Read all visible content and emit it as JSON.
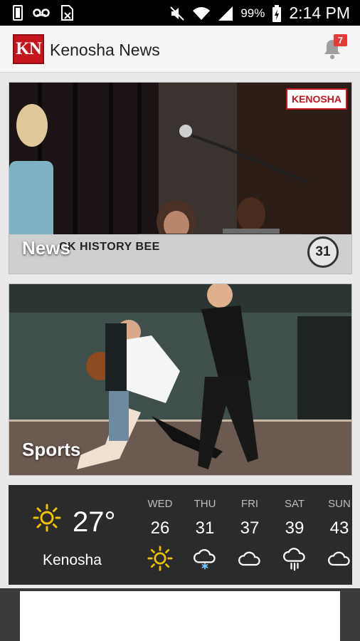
{
  "status_bar": {
    "battery": "99%",
    "time": "2:14 PM"
  },
  "app": {
    "logo_text": "KN",
    "title": "Kenosha News",
    "notification_count": "7"
  },
  "cards": [
    {
      "label": "News",
      "banner_text": "CK HISTORY BEE",
      "badge_number": "31",
      "tag_text": "KENOSHA"
    },
    {
      "label": "Sports"
    }
  ],
  "weather": {
    "current_temp": "27°",
    "city": "Kenosha",
    "current_icon": "sun-icon",
    "forecast": [
      {
        "day": "WED",
        "temp": "26",
        "icon": "sun-icon"
      },
      {
        "day": "THU",
        "temp": "31",
        "icon": "snow-cloud-icon"
      },
      {
        "day": "FRI",
        "temp": "37",
        "icon": "cloud-icon"
      },
      {
        "day": "SAT",
        "temp": "39",
        "icon": "rain-cloud-icon"
      },
      {
        "day": "SUN",
        "temp": "43",
        "icon": "cloud-icon"
      }
    ],
    "colors": {
      "sun": "#f2c400",
      "snow": "#6ec6ff",
      "icon_white": "#ffffff"
    }
  }
}
